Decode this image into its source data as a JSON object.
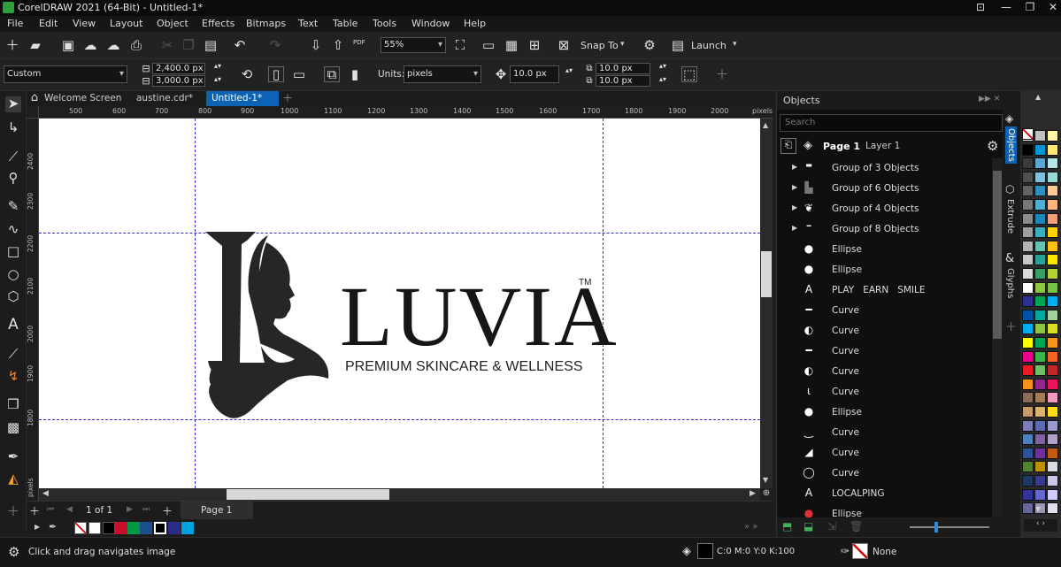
{
  "app": {
    "title": "CorelDRAW 2021 (64-Bit) - Untitled-1*"
  },
  "menu": [
    "File",
    "Edit",
    "View",
    "Layout",
    "Object",
    "Effects",
    "Bitmaps",
    "Text",
    "Table",
    "Tools",
    "Window",
    "Help"
  ],
  "standard_bar": {
    "zoom": "55%",
    "snap_to": "Snap To",
    "launch": "Launch",
    "pdf_label": "PDF"
  },
  "property_bar": {
    "preset": "Custom",
    "width": "2,400.0 px",
    "height": "3,000.0 px",
    "units_label": "Units:",
    "units": "pixels",
    "nudge": "10.0 px",
    "dup_x": "10.0 px",
    "dup_y": "10.0 px"
  },
  "doc_tabs": [
    {
      "label": "Welcome Screen",
      "active": false
    },
    {
      "label": "austine.cdr*",
      "active": false
    },
    {
      "label": "Untitled-1*",
      "active": true
    }
  ],
  "ruler_h": [
    "500",
    "600",
    "700",
    "800",
    "900",
    "1000",
    "1100",
    "1200",
    "1300",
    "1400",
    "1500",
    "1600",
    "1700",
    "1800",
    "1900",
    "2000"
  ],
  "ruler_h_unit": "pixels",
  "ruler_v": [
    "2400",
    "2300",
    "2200",
    "2100",
    "2000",
    "1900",
    "1800"
  ],
  "ruler_v_unit": "pixels",
  "logo": {
    "brand": "LUVIA",
    "tm": "TM",
    "tagline": "PREMIUM SKINCARE & WELLNESS"
  },
  "page_nav": {
    "position": "1 of 1",
    "page_tab": "Page 1"
  },
  "objects_panel": {
    "title": "Objects",
    "search_placeholder": "Search",
    "page": "Page 1",
    "layer": "Layer 1",
    "items": [
      {
        "label": "Group of 3 Objects",
        "expandable": true,
        "icon": "group-icon"
      },
      {
        "label": "Group of 6 Objects",
        "expandable": true,
        "icon": "group-icon"
      },
      {
        "label": "Group of 4 Objects",
        "expandable": true,
        "icon": "group-icon"
      },
      {
        "label": "Group of 8 Objects",
        "expandable": true,
        "icon": "group-icon"
      },
      {
        "label": "Ellipse",
        "expandable": false,
        "icon": "ellipse-icon"
      },
      {
        "label": "Ellipse",
        "expandable": false,
        "icon": "ellipse-icon"
      },
      {
        "label": "PLAY   EARN   SMILE",
        "expandable": false,
        "icon": "text-icon"
      },
      {
        "label": "Curve",
        "expandable": false,
        "icon": "curve-icon"
      },
      {
        "label": "Curve",
        "expandable": false,
        "icon": "curve-icon"
      },
      {
        "label": "Curve",
        "expandable": false,
        "icon": "curve-icon"
      },
      {
        "label": "Curve",
        "expandable": false,
        "icon": "curve-icon"
      },
      {
        "label": "Curve",
        "expandable": false,
        "icon": "curve-icon"
      },
      {
        "label": "Ellipse",
        "expandable": false,
        "icon": "ellipse-icon"
      },
      {
        "label": "Curve",
        "expandable": false,
        "icon": "curve-icon"
      },
      {
        "label": "Curve",
        "expandable": false,
        "icon": "curve-icon"
      },
      {
        "label": "Curve",
        "expandable": false,
        "icon": "curve-icon"
      },
      {
        "label": "LOCALPING",
        "expandable": false,
        "icon": "text-icon"
      },
      {
        "label": "Ellipse",
        "expandable": false,
        "icon": "ellipse-red-icon"
      }
    ]
  },
  "side_tabs": [
    "Objects",
    "Extrude",
    "Glyphs"
  ],
  "status": {
    "hint": "Click and drag navigates image",
    "fill": "C:0 M:0 Y:0 K:100",
    "outline": "None"
  },
  "doc_palette": [
    "#ffffff",
    "#ffffff",
    "#000000",
    "#c8102e",
    "#009a44",
    "#1f4e8c",
    "#000000",
    "#2b2b8c",
    "#00a3e0"
  ],
  "palette_colors": [
    [
      "#ffffff",
      "#c0c0c0",
      "#fff7a8"
    ],
    [
      "#000000",
      "#0096d6",
      "#ffe873"
    ],
    [
      "#3c3c3c",
      "#5aa5d4",
      "#b7e6e6"
    ],
    [
      "#505050",
      "#7fbfdf",
      "#9ad7d7"
    ],
    [
      "#646464",
      "#2e8fc1",
      "#ffcc99"
    ],
    [
      "#787878",
      "#4dadd6",
      "#ffb380"
    ],
    [
      "#8c8c8c",
      "#1a88b8",
      "#f2a07b"
    ],
    [
      "#a0a0a0",
      "#3baec3",
      "#ffd200"
    ],
    [
      "#b4b4b4",
      "#66c2b4",
      "#ffc20e"
    ],
    [
      "#c8c8c8",
      "#2aa198",
      "#ffe600"
    ],
    [
      "#dcdcdc",
      "#37a064",
      "#b2d235"
    ],
    [
      "#ffffff",
      "#8dc63f",
      "#7ac143"
    ],
    [
      "#2e3192",
      "#00a651",
      "#00aeef"
    ],
    [
      "#0054a6",
      "#00a99d",
      "#a3d39c"
    ],
    [
      "#00aeef",
      "#8cc63f",
      "#d9e021"
    ],
    [
      "#ffff00",
      "#00a651",
      "#f7941d"
    ],
    [
      "#ec008c",
      "#39b54a",
      "#f26522"
    ],
    [
      "#ed1c24",
      "#6dc066",
      "#c1272d"
    ],
    [
      "#f7941d",
      "#92278f",
      "#ed145b"
    ],
    [
      "#8b6b5a",
      "#a67c52",
      "#f49ac1"
    ],
    [
      "#c69c6d",
      "#d8b26e",
      "#ffde17"
    ],
    [
      "#7d7db8",
      "#5e6ab0",
      "#9999cc"
    ],
    [
      "#4f81bd",
      "#8064a2",
      "#b3a2c7"
    ],
    [
      "#2f5496",
      "#7030a0",
      "#c55a11"
    ],
    [
      "#548235",
      "#bf9000",
      "#d6dce4"
    ],
    [
      "#1f3864",
      "#3a3a8c",
      "#c9c9e6"
    ],
    [
      "#333399",
      "#6666cc",
      "#ccccff"
    ],
    [
      "#666699",
      "#9999b3",
      "#e0e0f0"
    ]
  ]
}
